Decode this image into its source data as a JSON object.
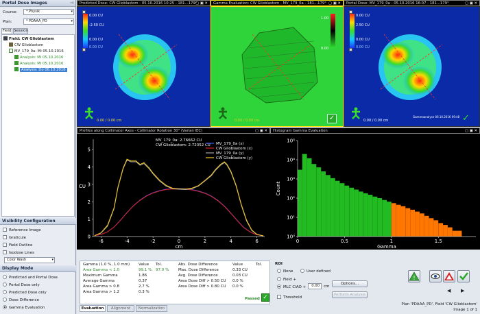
{
  "left_panel": {
    "title": "Portal Dose Images",
    "course_label": "Course:",
    "course_value": "* Physik",
    "plan_label": "Plan:",
    "plan_value": "* PDAAA_PD",
    "tabs": [
      "Field",
      "Session"
    ],
    "tree": {
      "field": "Field: CW Glioblastom",
      "image": "CW Glioblastom",
      "acquisition": "MV_179_0a: Mi 05.10.2016",
      "analyses": [
        "Analysis: Mi 05.10.2016",
        "Analysis: Mi 05.10.2016",
        "Analysis: Do 06.10.2016"
      ]
    },
    "visibility": {
      "title": "Visibility Configuration",
      "items": [
        "Reference Image",
        "Graticule",
        "Field Outline",
        "Isodose Lines"
      ],
      "color_mode": "Color Wash"
    },
    "display_mode": {
      "title": "Display Mode",
      "options": [
        "Predicted and Portal Dose",
        "Portal Dose only",
        "Predicted Dose only",
        "Dose Difference",
        "Gamma Evaluation"
      ],
      "selected": "Gamma Evaluation"
    }
  },
  "views": {
    "predicted": {
      "title": "Predicted Dose: CW Glioblastom - 05.10.2016 10:25 - 181...179°",
      "cbar_labels": [
        "0.00 CU",
        "-2.50 CU",
        "0.00 CU",
        "0.00 CU"
      ],
      "coord": "0.00 / 0.00 cm"
    },
    "gamma": {
      "title": "Gamma Evaluation: CW Glioblastom - MV_179_0a - 181...179°",
      "cbar_labels": [
        "1.00",
        "0.00"
      ],
      "coord": "0.00 / 0.00 cm"
    },
    "portal": {
      "title": "Portal Dose: MV_179_0a - 05.10.2016 16:07 - 181...179°",
      "cbar_labels": [
        "0.00 CU",
        "2.50 CU",
        "0.00 CU",
        "0.00 CU"
      ],
      "coord": "0.00 / 0.00 cm",
      "stamp": "Gammaanalyse 06.10.2016 09:48"
    },
    "tools": "▢ ▣ ✕"
  },
  "profile_title": "Profiles along Collimator Axes - Collimator Rotation 30° (Varian IEC)",
  "histogram_title": "Histogram Gamma Evaluation",
  "profile_chart": {
    "type": "line",
    "title": "",
    "xlabel": "cm",
    "ylabel": "CU",
    "xlim": [
      -6.6,
      6.6
    ],
    "ylim": [
      0,
      5.6
    ],
    "xticks": [
      -6,
      -4,
      -2,
      0,
      2,
      4,
      6
    ],
    "yticks": [
      0,
      1,
      2,
      3,
      4,
      5
    ],
    "readout": [
      "MV_179_0a: 2.76662 CU",
      "CW Glioblastom: 2.72352 CU"
    ],
    "series": [
      {
        "name": "MV_179_0a (x)",
        "color": "#4a5cff",
        "x": [
          -6.5,
          -6,
          -5.5,
          -5,
          -4.5,
          -4,
          -3.5,
          -3,
          -2.5,
          -2,
          -1.5,
          -1,
          -0.5,
          0,
          0.5,
          1,
          1.5,
          2,
          2.5,
          3,
          3.5,
          4,
          4.5,
          5,
          5.5,
          6,
          6.5
        ],
        "y": [
          0.05,
          0.12,
          0.28,
          0.55,
          0.95,
          1.38,
          1.78,
          2.1,
          2.35,
          2.52,
          2.64,
          2.72,
          2.75,
          2.76,
          2.74,
          2.7,
          2.62,
          2.5,
          2.33,
          2.08,
          1.75,
          1.35,
          0.92,
          0.52,
          0.26,
          0.1,
          0.04
        ]
      },
      {
        "name": "CW Glioblastom (x)",
        "color": "#d81e1e",
        "x": [
          -6.5,
          -6,
          -5.5,
          -5,
          -4.5,
          -4,
          -3.5,
          -3,
          -2.5,
          -2,
          -1.5,
          -1,
          -0.5,
          0,
          0.5,
          1,
          1.5,
          2,
          2.5,
          3,
          3.5,
          4,
          4.5,
          5,
          5.5,
          6,
          6.5
        ],
        "y": [
          0.05,
          0.12,
          0.27,
          0.54,
          0.94,
          1.37,
          1.77,
          2.08,
          2.33,
          2.5,
          2.62,
          2.7,
          2.73,
          2.72,
          2.72,
          2.68,
          2.6,
          2.48,
          2.31,
          2.06,
          1.73,
          1.33,
          0.9,
          0.5,
          0.25,
          0.1,
          0.04
        ]
      },
      {
        "name": "MV_179_0a (y)",
        "color": "#a6a6a6",
        "x": [
          -6.5,
          -6,
          -5.5,
          -5,
          -4.7,
          -4.3,
          -4,
          -3.7,
          -3.3,
          -3,
          -2.7,
          -2.3,
          -2,
          -1.5,
          -1,
          -0.5,
          0,
          0.5,
          1,
          1.5,
          2,
          2.5,
          2.8,
          3.2,
          3.5,
          3.7,
          4,
          4.4,
          4.8,
          5.2,
          5.6,
          6,
          6.5
        ],
        "y": [
          0.05,
          0.2,
          0.6,
          1.6,
          2.8,
          3.9,
          4.4,
          4.3,
          4.3,
          4.1,
          4.2,
          3.9,
          3.6,
          3.2,
          2.9,
          2.75,
          2.72,
          2.7,
          2.75,
          2.9,
          3.2,
          3.5,
          3.8,
          4.1,
          4.25,
          4.1,
          3.7,
          2.9,
          1.8,
          0.9,
          0.35,
          0.12,
          0.04
        ]
      },
      {
        "name": "CW Glioblastom (y)",
        "color": "#f2c41d",
        "x": [
          -6.5,
          -6,
          -5.5,
          -5,
          -4.7,
          -4.3,
          -4,
          -3.7,
          -3.3,
          -3,
          -2.7,
          -2.3,
          -2,
          -1.5,
          -1,
          -0.5,
          0,
          0.5,
          1,
          1.5,
          2,
          2.5,
          2.8,
          3.2,
          3.5,
          3.7,
          4,
          4.4,
          4.8,
          5.2,
          5.6,
          6,
          6.5
        ],
        "y": [
          0.05,
          0.22,
          0.65,
          1.65,
          2.85,
          3.95,
          4.45,
          4.35,
          4.35,
          4.15,
          4.25,
          3.95,
          3.65,
          3.25,
          2.95,
          2.78,
          2.74,
          2.73,
          2.78,
          2.93,
          3.23,
          3.55,
          3.85,
          4.15,
          4.3,
          4.15,
          3.75,
          2.95,
          1.85,
          0.95,
          0.38,
          0.13,
          0.04
        ]
      }
    ]
  },
  "histogram_chart": {
    "type": "bar",
    "title": "",
    "xlabel": "Gamma",
    "ylabel": "Count",
    "xlim": [
      0,
      1.9
    ],
    "yscale": "log",
    "ylim": [
      1,
      100000
    ],
    "xticks": [
      0,
      0.5,
      1,
      1.5
    ],
    "yticks": [
      1,
      10,
      100,
      1000,
      10000,
      100000
    ],
    "ytick_labels": [
      "10⁰",
      "10¹",
      "10²",
      "10³",
      "10⁴",
      "10⁵"
    ],
    "pass_color": "#22bb22",
    "fail_color": "#ff7700",
    "threshold": 1.0,
    "bins": [
      0.0,
      0.05,
      0.1,
      0.15,
      0.2,
      0.25,
      0.3,
      0.35,
      0.4,
      0.45,
      0.5,
      0.55,
      0.6,
      0.65,
      0.7,
      0.75,
      0.8,
      0.85,
      0.9,
      0.95,
      1.0,
      1.05,
      1.1,
      1.15,
      1.2,
      1.25,
      1.3,
      1.35,
      1.4,
      1.45,
      1.5,
      1.55,
      1.6,
      1.65,
      1.7,
      1.75,
      1.8
    ],
    "counts": [
      3000,
      20000,
      12000,
      6000,
      4000,
      2500,
      1600,
      1100,
      800,
      600,
      450,
      350,
      280,
      220,
      180,
      150,
      120,
      100,
      80,
      65,
      55,
      45,
      38,
      30,
      25,
      20,
      16,
      12,
      9,
      7,
      5,
      4,
      3,
      2,
      2,
      1,
      1
    ]
  },
  "gamma_table": {
    "headers": [
      "Gamma (1.0 %, 1.0 mm)",
      "Value",
      "Tol."
    ],
    "rows": [
      [
        "Area Gamma < 1.0",
        "99.1 %",
        "97.0 %"
      ],
      [
        "Maximum Gamma",
        "1.86",
        ""
      ],
      [
        "Average Gamma",
        "0.37",
        ""
      ],
      [
        "Area Gamma > 0.8",
        "2.7 %",
        ""
      ],
      [
        "Area Gamma > 1.2",
        "0.3 %",
        ""
      ]
    ]
  },
  "dose_table": {
    "headers": [
      "Abs. Dose Difference",
      "Value",
      "Tol."
    ],
    "rows": [
      [
        "Max. Dose Difference",
        "0.33 CU",
        ""
      ],
      [
        "Avg. Dose Difference",
        "0.03 CU",
        ""
      ],
      [
        "Area Dose Diff > 0.50 CU",
        "0.0 %",
        ""
      ],
      [
        "Area Dose Diff > 0.80 CU",
        "0.0 %",
        ""
      ]
    ]
  },
  "result": "Passed",
  "roi": {
    "title": "ROI",
    "options": [
      "None",
      "User defined",
      "Field +",
      "MLC CIAO +"
    ],
    "selected": "MLC CIAO +",
    "value": "0.00",
    "unit": "cm",
    "threshold": "Threshold",
    "options_btn": "Options...",
    "perform_btn": "Perform Analysis"
  },
  "bottom_tabs": [
    "Evaluation",
    "Alignment",
    "Normalization"
  ],
  "status": {
    "line1": "Plan 'PDAAA_PD', Field 'CW Glioblastom'",
    "line2": "Image 1 of 1"
  }
}
